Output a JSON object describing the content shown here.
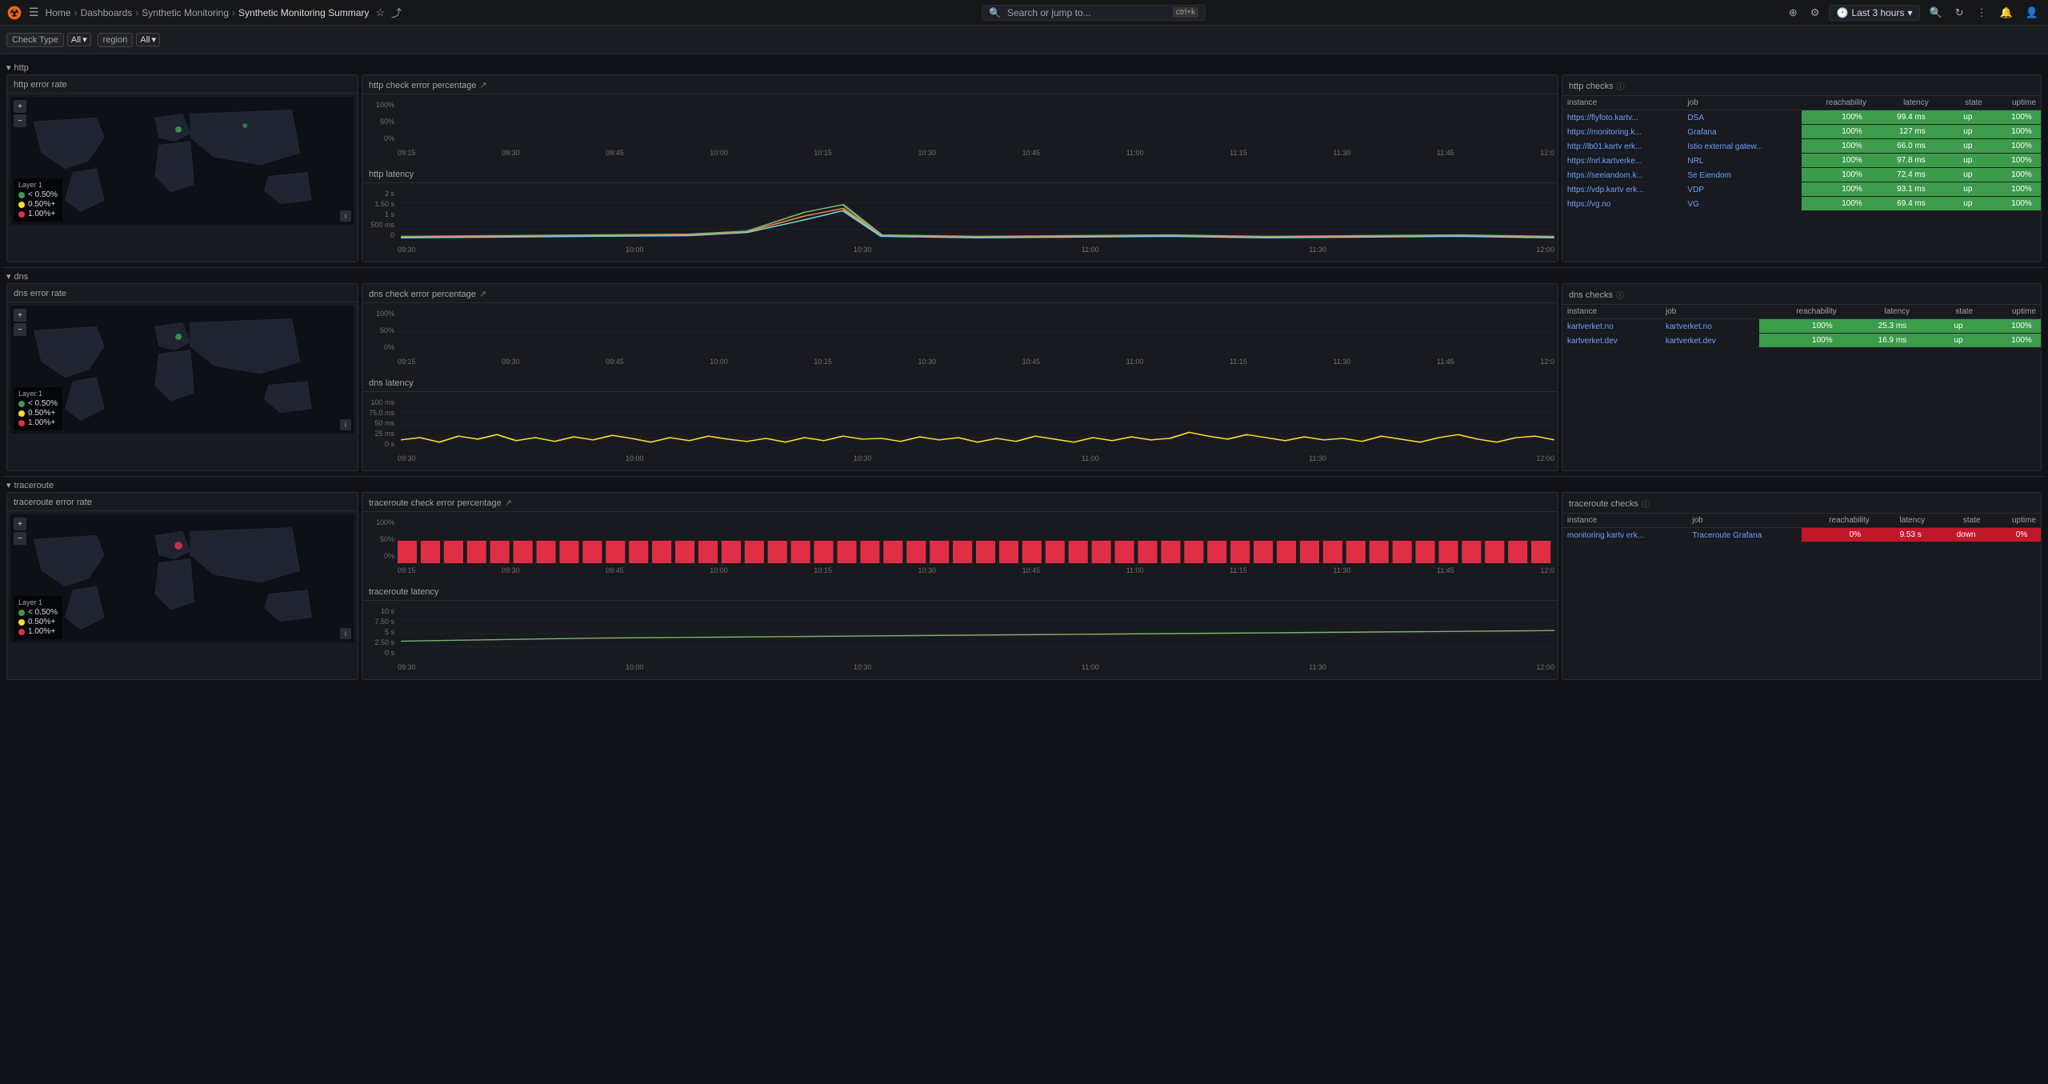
{
  "app": {
    "logo_icon": "grafana-logo",
    "title": "Synthetic Monitoring Summary"
  },
  "topbar": {
    "search_placeholder": "Search or jump to...",
    "search_shortcut": "ctrl+k",
    "breadcrumb": [
      {
        "label": "Home",
        "href": "#"
      },
      {
        "label": "Dashboards",
        "href": "#"
      },
      {
        "label": "Synthetic Monitoring",
        "href": "#"
      },
      {
        "label": "Synthetic Monitoring Summary",
        "href": "#"
      }
    ],
    "time_range": "Last 3 hours",
    "plus_label": "+",
    "clock_icon": "clock-icon",
    "bell_icon": "bell-icon",
    "user_icon": "user-icon",
    "settings_icon": "settings-icon",
    "refresh_icon": "refresh-icon",
    "zoom_out_icon": "zoom-out-icon"
  },
  "filters": {
    "check_type_label": "Check Type",
    "check_type_value": "All",
    "region_label": "region",
    "region_value": "All"
  },
  "sections": [
    {
      "id": "http",
      "label": "http",
      "collapsed": false,
      "map_panel": {
        "title": "http error rate",
        "legend": [
          {
            "color": "#3d9c4c",
            "label": "< 0.50%"
          },
          {
            "color": "#fade2a",
            "label": "0.50%+"
          },
          {
            "color": "#e02f44",
            "label": "1.00%+"
          }
        ],
        "layer_label": "Layer 1"
      },
      "error_chart": {
        "title": "http check error percentage",
        "y_labels": [
          "100%",
          "50%",
          "0%"
        ],
        "x_labels": [
          "09:15",
          "09:30",
          "09:45",
          "10:00",
          "10:15",
          "10:30",
          "10:45",
          "11:00",
          "11:15",
          "11:30",
          "11:45",
          "12:0"
        ]
      },
      "latency_chart": {
        "title": "http latency",
        "y_labels": [
          "2 s",
          "1.50 s",
          "1 s",
          "500 ms",
          "0"
        ],
        "x_labels": [
          "09:30",
          "10:00",
          "10:30",
          "11:00",
          "11:30",
          "12:00"
        ]
      },
      "checks_panel": {
        "title": "http checks",
        "columns": [
          "instance",
          "job",
          "reachability",
          "latency",
          "state",
          "uptime"
        ],
        "rows": [
          {
            "instance": "https://flyfoto.kartv...",
            "job": "DSA",
            "reachability": "100%",
            "latency": "99.4 ms",
            "state": "up",
            "uptime": "100%",
            "status": "green"
          },
          {
            "instance": "https://monitoring.k...",
            "job": "Grafana",
            "reachability": "100%",
            "latency": "127 ms",
            "state": "up",
            "uptime": "100%",
            "status": "green"
          },
          {
            "instance": "http://lb01.kartv erk...",
            "job": "Istio external gatew...",
            "reachability": "100%",
            "latency": "66.0 ms",
            "state": "up",
            "uptime": "100%",
            "status": "green"
          },
          {
            "instance": "https://nrl.kartverke...",
            "job": "NRL",
            "reachability": "100%",
            "latency": "97.8 ms",
            "state": "up",
            "uptime": "100%",
            "status": "green"
          },
          {
            "instance": "https://seeiandom.k...",
            "job": "Se Eiendom",
            "reachability": "100%",
            "latency": "72.4 ms",
            "state": "up",
            "uptime": "100%",
            "status": "green"
          },
          {
            "instance": "https://vdp.kartv erk...",
            "job": "VDP",
            "reachability": "100%",
            "latency": "93.1 ms",
            "state": "up",
            "uptime": "100%",
            "status": "green"
          },
          {
            "instance": "https://vg.no",
            "job": "VG",
            "reachability": "100%",
            "latency": "69.4 ms",
            "state": "up",
            "uptime": "100%",
            "status": "green"
          }
        ]
      }
    },
    {
      "id": "dns",
      "label": "dns",
      "collapsed": false,
      "map_panel": {
        "title": "dns error rate",
        "legend": [
          {
            "color": "#3d9c4c",
            "label": "< 0.50%"
          },
          {
            "color": "#fade2a",
            "label": "0.50%+"
          },
          {
            "color": "#e02f44",
            "label": "1.00%+"
          }
        ],
        "layer_label": "Layer 1"
      },
      "error_chart": {
        "title": "dns check error percentage",
        "y_labels": [
          "100%",
          "50%",
          "0%"
        ],
        "x_labels": [
          "09:15",
          "09:30",
          "09:45",
          "10:00",
          "10:15",
          "10:30",
          "10:45",
          "11:00",
          "11:15",
          "11:30",
          "11:45",
          "12:0"
        ]
      },
      "latency_chart": {
        "title": "dns latency",
        "y_labels": [
          "100 ms",
          "75.0 ms",
          "50 ms",
          "25 ms",
          "0 s"
        ],
        "x_labels": [
          "09:30",
          "10:00",
          "10:30",
          "11:00",
          "11:30",
          "12:00"
        ]
      },
      "checks_panel": {
        "title": "dns checks",
        "columns": [
          "instance",
          "job",
          "reachability",
          "latency",
          "state",
          "uptime"
        ],
        "rows": [
          {
            "instance": "kartverket.no",
            "job": "kartverket.no",
            "reachability": "100%",
            "latency": "25.3 ms",
            "state": "up",
            "uptime": "100%",
            "status": "green"
          },
          {
            "instance": "kartverket.dev",
            "job": "kartverket.dev",
            "reachability": "100%",
            "latency": "16.9 ms",
            "state": "up",
            "uptime": "100%",
            "status": "green"
          }
        ]
      }
    },
    {
      "id": "traceroute",
      "label": "traceroute",
      "collapsed": false,
      "map_panel": {
        "title": "traceroute error rate",
        "legend": [
          {
            "color": "#3d9c4c",
            "label": "< 0.50%"
          },
          {
            "color": "#fade2a",
            "label": "0.50%+"
          },
          {
            "color": "#e02f44",
            "label": "1.00%+"
          }
        ],
        "layer_label": "Layer 1"
      },
      "error_chart": {
        "title": "traceroute check error percentage",
        "y_labels": [
          "100%",
          "50%",
          "0%"
        ],
        "x_labels": [
          "09:15",
          "09:30",
          "09:45",
          "10:00",
          "10:15",
          "10:30",
          "10:45",
          "11:00",
          "11:15",
          "11:30",
          "11:45",
          "12:0"
        ]
      },
      "latency_chart": {
        "title": "traceroute latency",
        "y_labels": [
          "10 s",
          "7.50 s",
          "5 s",
          "2.50 s",
          "0 s"
        ],
        "x_labels": [
          "09:30",
          "10:00",
          "10:30",
          "11:00",
          "11:30",
          "12:00"
        ]
      },
      "checks_panel": {
        "title": "traceroute checks",
        "columns": [
          "instance",
          "job",
          "reachability",
          "latency",
          "state",
          "uptime"
        ],
        "rows": [
          {
            "instance": "monitoring.kartv erk...",
            "job": "Traceroute Grafana",
            "reachability": "0%",
            "latency": "9.53 s",
            "state": "down",
            "uptime": "0%",
            "status": "red"
          }
        ]
      }
    }
  ]
}
